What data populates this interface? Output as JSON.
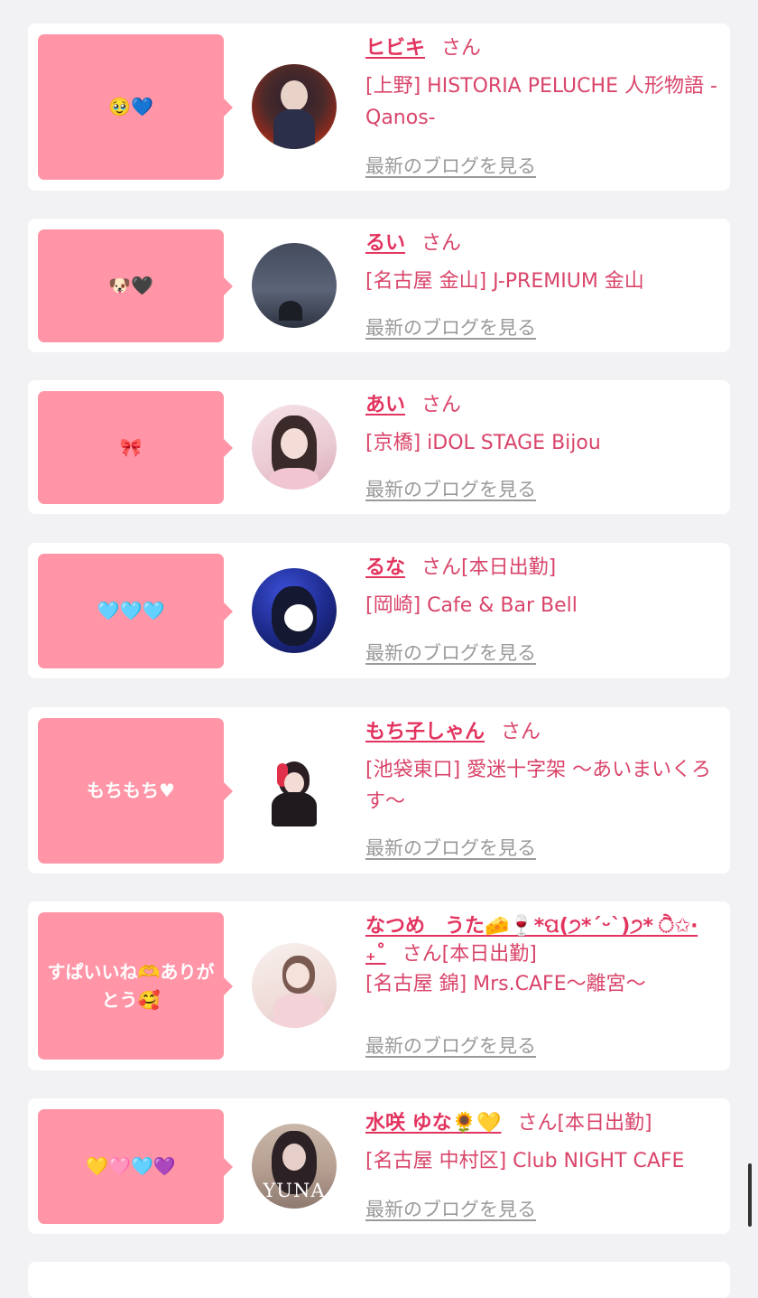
{
  "list": {
    "blog_link_label": "最新のブログを見る",
    "items": [
      {
        "message": "🥹💙",
        "name": "ヒビキ",
        "honorific": "さん",
        "status": "",
        "shop": "[上野] HISTORIA PELUCHE 人形物語 -Qanos-"
      },
      {
        "message": "🐶🖤",
        "name": "るい",
        "honorific": "さん",
        "status": "",
        "shop": "[名古屋 金山] J-PREMIUM 金山"
      },
      {
        "message": "🎀",
        "name": "あい",
        "honorific": "さん",
        "status": "",
        "shop": "[京橋] iDOL STAGE Bijou"
      },
      {
        "message": "🩵🩵🩵",
        "name": "るな",
        "honorific": "さん",
        "status": "[本日出勤]",
        "shop": "[岡崎] Cafe & Bar Bell"
      },
      {
        "message": "もちもち♥",
        "name": "もち子しゃん",
        "honorific": "さん",
        "status": "",
        "shop": "[池袋東口] 愛迷十字架 〜あいまいくろす〜"
      },
      {
        "message": "すぱいいね🫶ありがとう🥰",
        "name": "なつめ　うた🧀🍷*ପ(੭*ˊᵕˋ)੭* ੈ✩‧₊˚",
        "honorific": "さん",
        "status": "[本日出勤]",
        "shop": "[名古屋 錦] Mrs.CAFE〜離宮〜"
      },
      {
        "message": "💛🩷🩵💜",
        "name": "水咲 ゆな🌻💛",
        "honorific": "さん",
        "status": "[本日出勤]",
        "shop": "[名古屋 中村区] Club NIGHT CAFE"
      }
    ]
  },
  "avatar_labels": {
    "item7": "YUNA"
  },
  "colors": {
    "accent": "#e2345f",
    "bubble": "#ff95a6",
    "background": "#f2f2f4"
  }
}
